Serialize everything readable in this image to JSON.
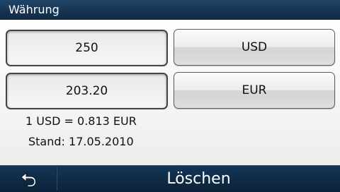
{
  "window": {
    "title": "Währung"
  },
  "converter": {
    "amount": "250",
    "from_currency": "USD",
    "result": "203.20",
    "to_currency": "EUR",
    "rate": "1 USD = 0.813 EUR",
    "date": "Stand: 17.05.2010"
  },
  "footer": {
    "back_icon": "back-arrow-icon",
    "delete_label": "Löschen"
  }
}
